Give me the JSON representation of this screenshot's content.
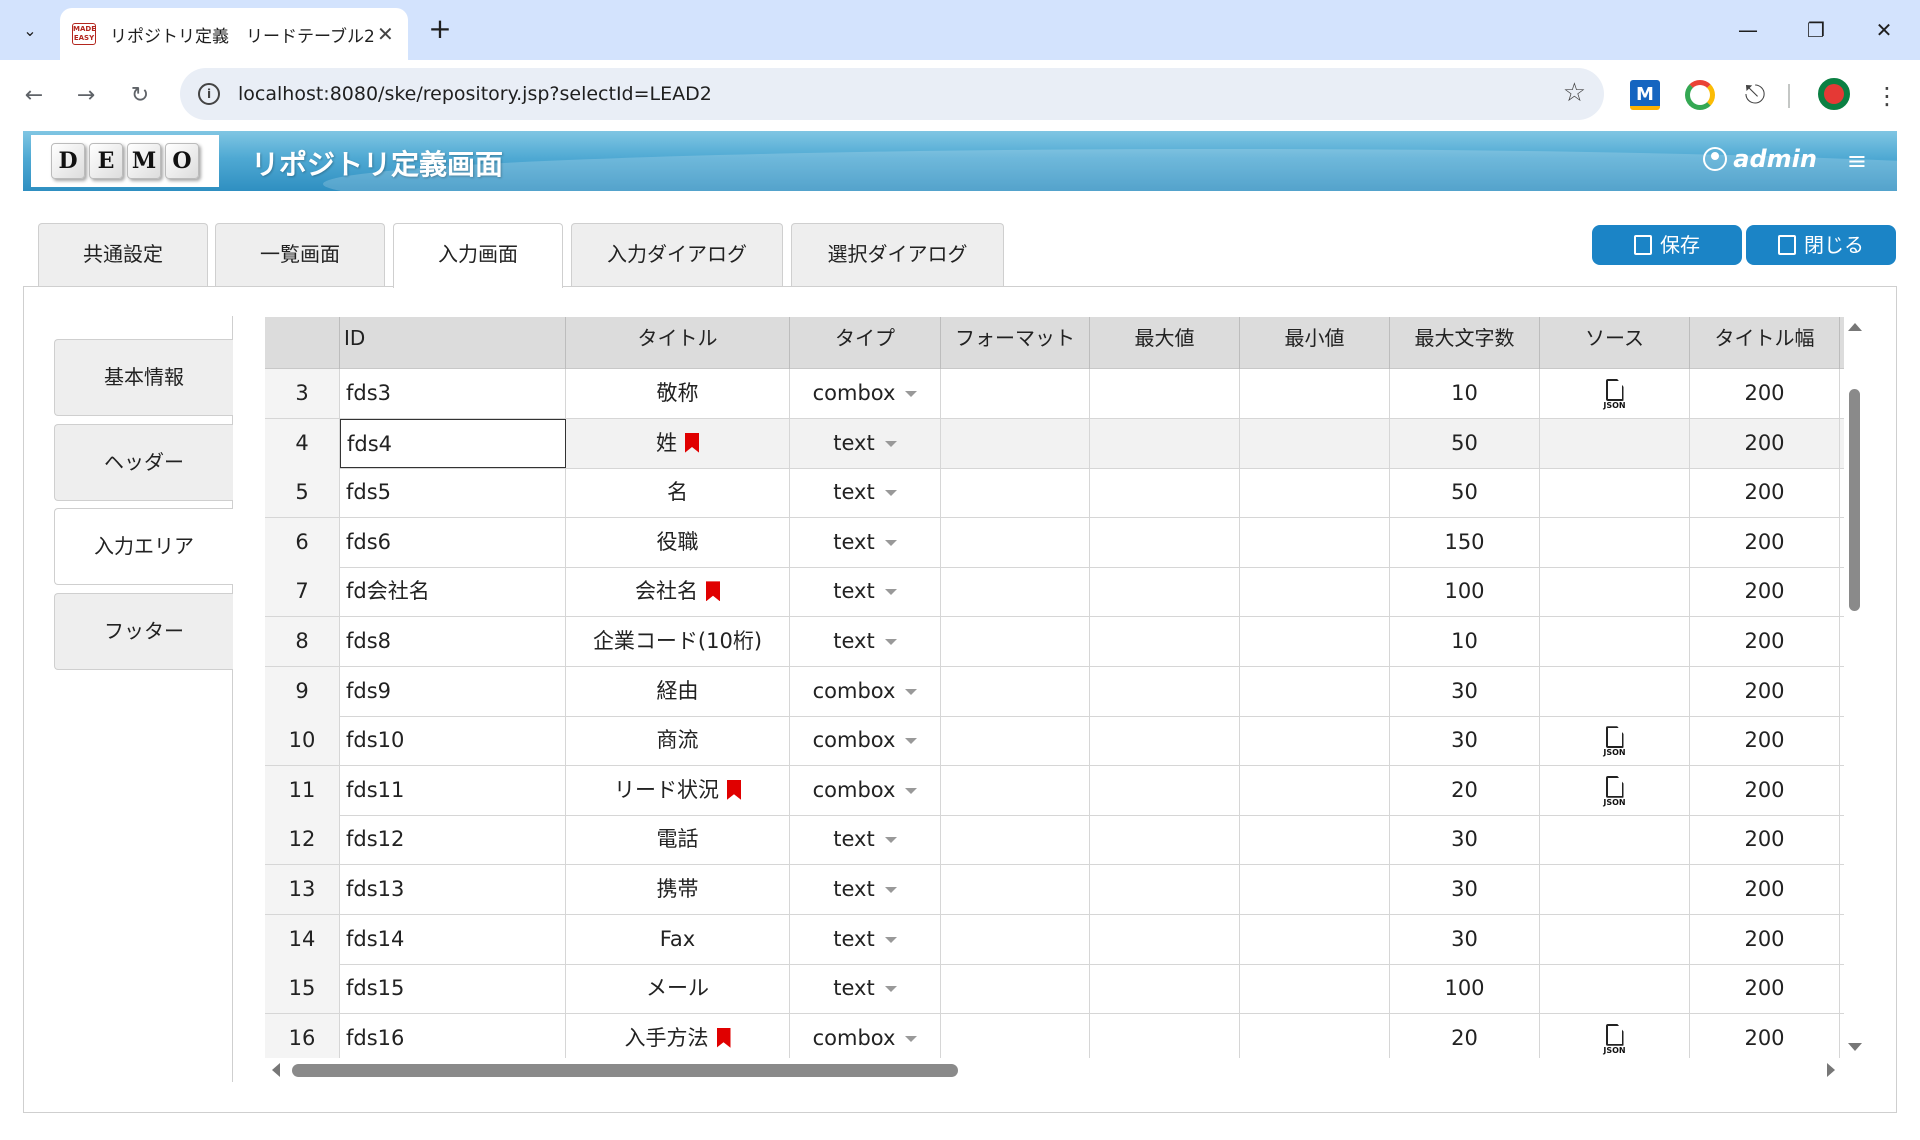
{
  "browser": {
    "tab_title": "リポジトリ定義　リードテーブル2",
    "favicon_text": "EASY",
    "url": "localhost:8080/ske/repository.jsp?selectId=LEAD2",
    "icons": [
      "tab-search-icon",
      "close-icon",
      "plus-icon",
      "minimize-icon",
      "restore-icon",
      "back-icon",
      "forward-icon",
      "reload-icon",
      "info-icon",
      "star-icon",
      "extension-icon",
      "more-icon"
    ],
    "extension_m_label": "M"
  },
  "header": {
    "logo_letters": [
      "D",
      "E",
      "M",
      "O"
    ],
    "title": "リポジトリ定義画面",
    "user": "admin"
  },
  "tabs": [
    {
      "label": "共通設定"
    },
    {
      "label": "一覧画面"
    },
    {
      "label": "入力画面",
      "active": true
    },
    {
      "label": "入力ダイアログ"
    },
    {
      "label": "選択ダイアログ"
    }
  ],
  "actions": {
    "save_label": "保存",
    "close_label": "閉じる"
  },
  "side_menu": [
    {
      "label": "基本情報"
    },
    {
      "label": "ヘッダー"
    },
    {
      "label": "入力エリア",
      "active": true
    },
    {
      "label": "フッター"
    }
  ],
  "grid": {
    "columns": [
      "ID",
      "タイトル",
      "タイプ",
      "フォーマット",
      "最大値",
      "最小値",
      "最大文字数",
      "ソース",
      "タイトル幅"
    ],
    "json_label": "JSON",
    "selected_row": "4",
    "rows": [
      {
        "no": "3",
        "id": "fds3",
        "title": "敬称",
        "required": false,
        "type": "combox",
        "format": "",
        "max": "",
        "min": "",
        "maxlen": "10",
        "source_json": true,
        "title_width": "200"
      },
      {
        "no": "4",
        "id": "fds4",
        "title": "姓",
        "required": true,
        "type": "text",
        "format": "",
        "max": "",
        "min": "",
        "maxlen": "50",
        "source_json": false,
        "title_width": "200"
      },
      {
        "no": "5",
        "id": "fds5",
        "title": "名",
        "required": false,
        "type": "text",
        "format": "",
        "max": "",
        "min": "",
        "maxlen": "50",
        "source_json": false,
        "title_width": "200"
      },
      {
        "no": "6",
        "id": "fds6",
        "title": "役職",
        "required": false,
        "type": "text",
        "format": "",
        "max": "",
        "min": "",
        "maxlen": "150",
        "source_json": false,
        "title_width": "200"
      },
      {
        "no": "7",
        "id": "fd会社名",
        "title": "会社名",
        "required": true,
        "type": "text",
        "format": "",
        "max": "",
        "min": "",
        "maxlen": "100",
        "source_json": false,
        "title_width": "200"
      },
      {
        "no": "8",
        "id": "fds8",
        "title": "企業コード(10桁)",
        "required": false,
        "type": "text",
        "format": "",
        "max": "",
        "min": "",
        "maxlen": "10",
        "source_json": false,
        "title_width": "200"
      },
      {
        "no": "9",
        "id": "fds9",
        "title": "経由",
        "required": false,
        "type": "combox",
        "format": "",
        "max": "",
        "min": "",
        "maxlen": "30",
        "source_json": false,
        "title_width": "200"
      },
      {
        "no": "10",
        "id": "fds10",
        "title": "商流",
        "required": false,
        "type": "combox",
        "format": "",
        "max": "",
        "min": "",
        "maxlen": "30",
        "source_json": true,
        "title_width": "200"
      },
      {
        "no": "11",
        "id": "fds11",
        "title": "リード状況",
        "required": true,
        "type": "combox",
        "format": "",
        "max": "",
        "min": "",
        "maxlen": "20",
        "source_json": true,
        "title_width": "200"
      },
      {
        "no": "12",
        "id": "fds12",
        "title": "電話",
        "required": false,
        "type": "text",
        "format": "",
        "max": "",
        "min": "",
        "maxlen": "30",
        "source_json": false,
        "title_width": "200"
      },
      {
        "no": "13",
        "id": "fds13",
        "title": "携帯",
        "required": false,
        "type": "text",
        "format": "",
        "max": "",
        "min": "",
        "maxlen": "30",
        "source_json": false,
        "title_width": "200"
      },
      {
        "no": "14",
        "id": "fds14",
        "title": "Fax",
        "required": false,
        "type": "text",
        "format": "",
        "max": "",
        "min": "",
        "maxlen": "30",
        "source_json": false,
        "title_width": "200"
      },
      {
        "no": "15",
        "id": "fds15",
        "title": "メール",
        "required": false,
        "type": "text",
        "format": "",
        "max": "",
        "min": "",
        "maxlen": "100",
        "source_json": false,
        "title_width": "200"
      },
      {
        "no": "16",
        "id": "fds16",
        "title": "入手方法",
        "required": true,
        "type": "combox",
        "format": "",
        "max": "",
        "min": "",
        "maxlen": "20",
        "source_json": true,
        "title_width": "200"
      }
    ]
  },
  "colors": {
    "header_blue": "#2f8fc1",
    "button_blue": "#1b84c6",
    "required_marker": "#e00000",
    "tab_bar": "#d3e3fd"
  }
}
